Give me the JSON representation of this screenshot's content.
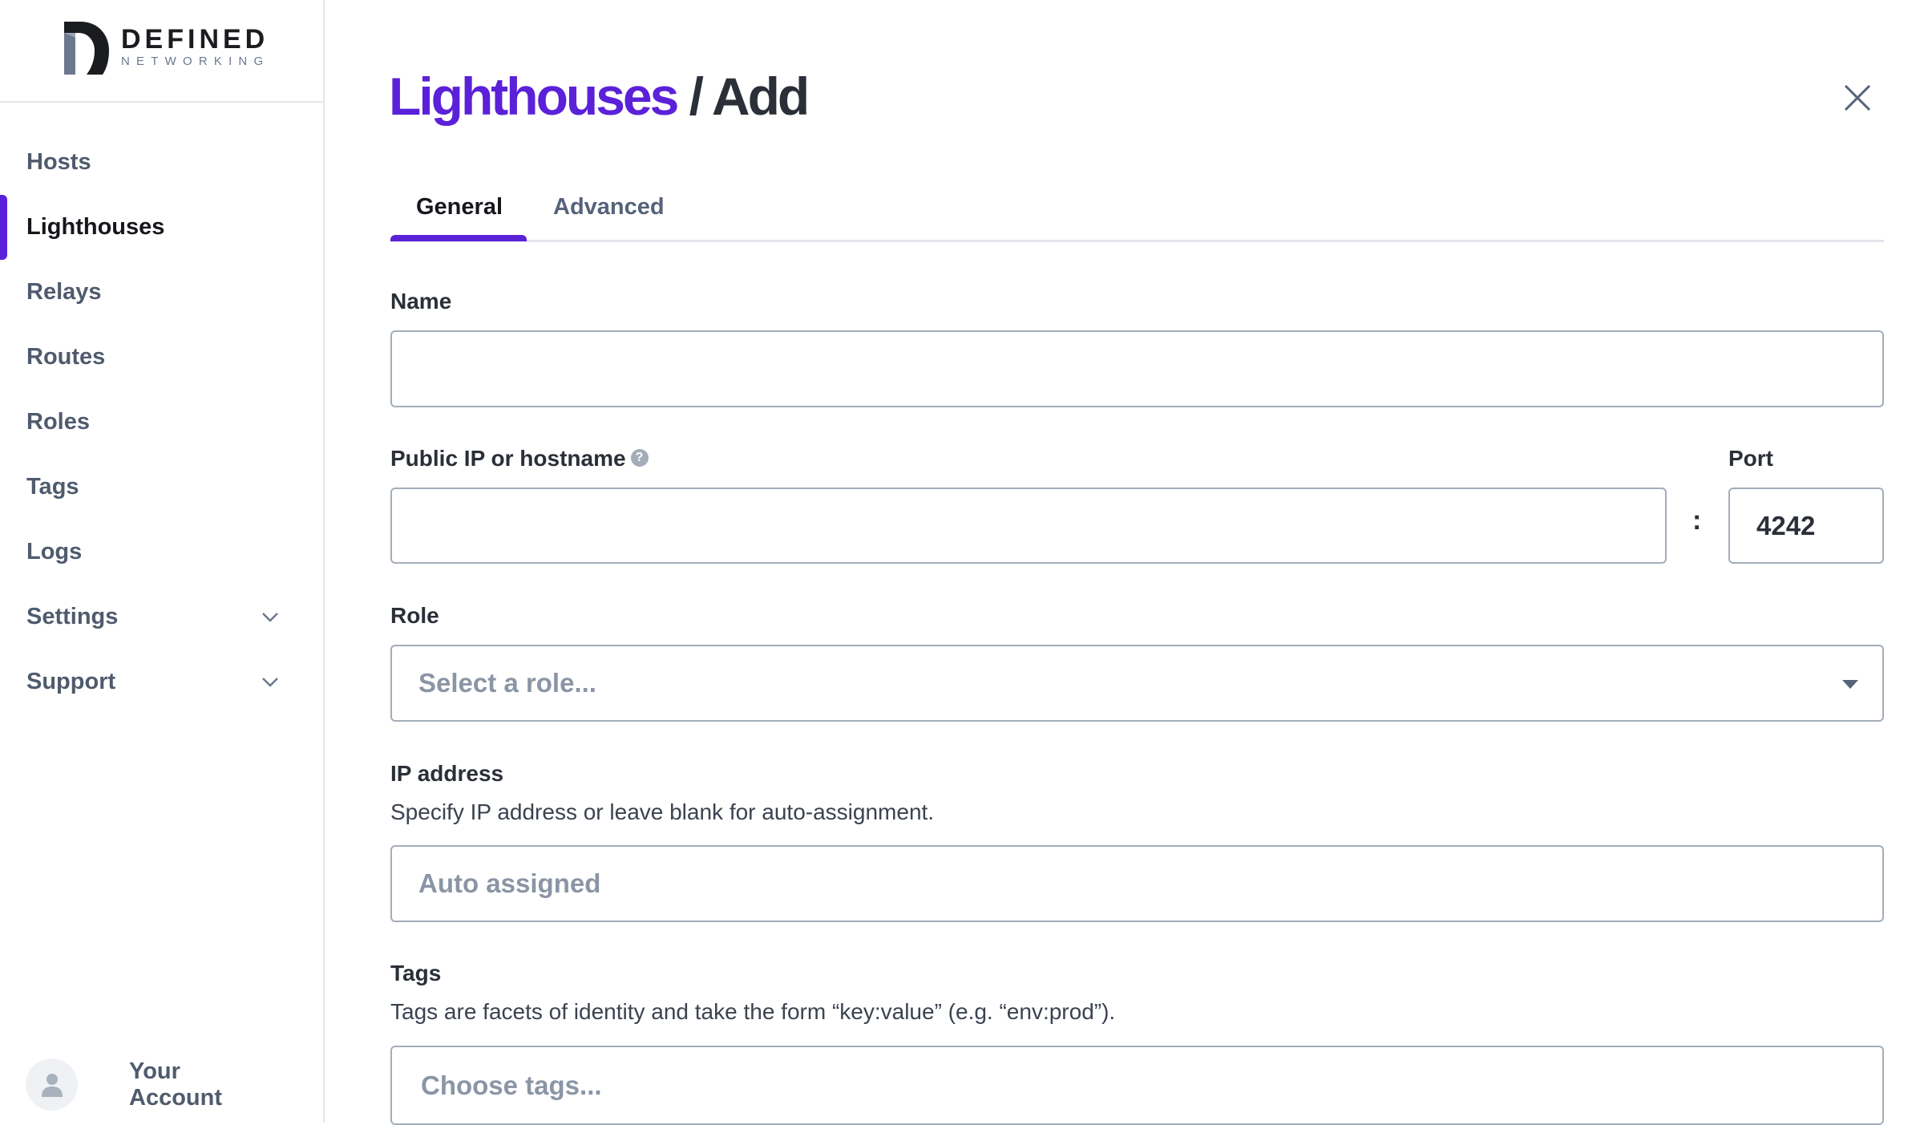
{
  "brand": {
    "name": "DEFINED",
    "sub": "NETWORKING"
  },
  "sidebar": {
    "items": [
      {
        "label": "Hosts"
      },
      {
        "label": "Lighthouses",
        "active": true
      },
      {
        "label": "Relays"
      },
      {
        "label": "Routes"
      },
      {
        "label": "Roles"
      },
      {
        "label": "Tags"
      },
      {
        "label": "Logs"
      },
      {
        "label": "Settings",
        "expandable": true
      },
      {
        "label": "Support",
        "expandable": true
      }
    ],
    "account_label": "Your Account"
  },
  "header": {
    "crumb": "Lighthouses",
    "separator": "/",
    "current": "Add"
  },
  "tabs": [
    {
      "label": "General",
      "active": true
    },
    {
      "label": "Advanced"
    }
  ],
  "form": {
    "name": {
      "label": "Name",
      "value": ""
    },
    "public_ip": {
      "label": "Public IP or hostname",
      "value": ""
    },
    "port": {
      "label": "Port",
      "value": "4242"
    },
    "colon": ":",
    "role": {
      "label": "Role",
      "placeholder": "Select a role..."
    },
    "ip_address": {
      "label": "IP address",
      "help": "Specify IP address or leave blank for auto-assignment.",
      "placeholder": "Auto assigned"
    },
    "tags": {
      "label": "Tags",
      "help": "Tags are facets of identity and take the form “key:value” (e.g. “env:prod”).",
      "placeholder": "Choose tags..."
    }
  },
  "colors": {
    "accent": "#5b21d9",
    "text": "#2a2f38",
    "muted": "#4f5b6d",
    "border": "#a3adba"
  }
}
